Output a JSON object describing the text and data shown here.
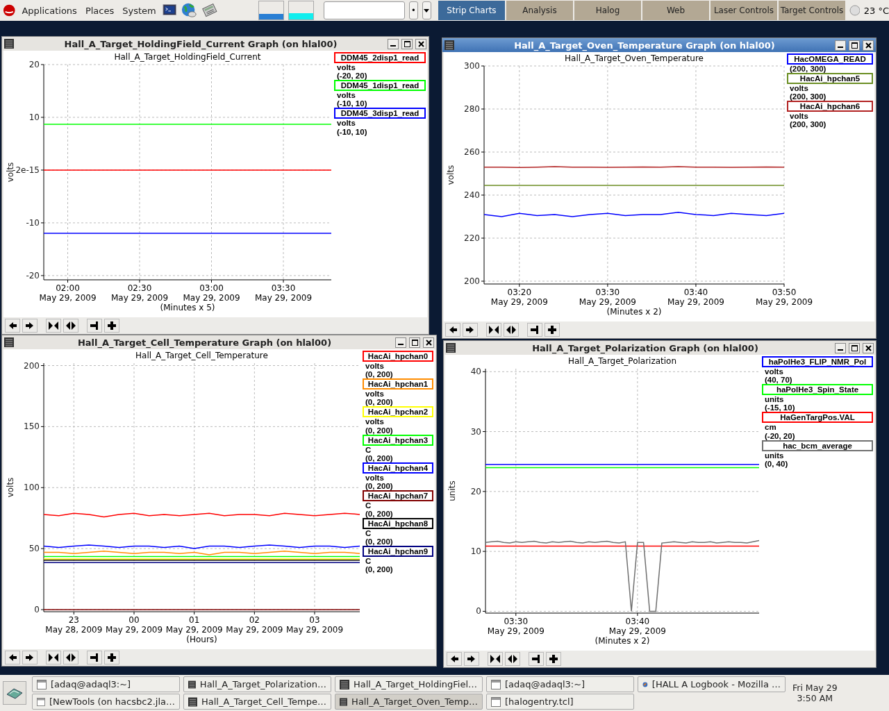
{
  "panel": {
    "menus": [
      "Applications",
      "Places",
      "System"
    ],
    "launchers": [
      {
        "kind": "terminal"
      },
      {
        "kind": "globe"
      },
      {
        "kind": "calculator"
      }
    ],
    "run_button": "•",
    "tabs": [
      {
        "label": "Strip Charts",
        "selected": true
      },
      {
        "label": "Analysis",
        "selected": false
      },
      {
        "label": "Halog",
        "selected": false
      },
      {
        "label": "Web",
        "selected": false
      },
      {
        "label": "Laser Controls",
        "selected": false
      },
      {
        "label": "Target Controls",
        "selected": false
      }
    ],
    "weather": "23 °C"
  },
  "windows": [
    {
      "title": "Hall_A_Target_HoldingField_Current Graph (on hlal00)",
      "active": false,
      "chart_data": {
        "type": "line",
        "title": "Hall_A_Target_HoldingField_Current",
        "xlabel": "(Minutes x 5)",
        "ylabel": "volts",
        "grid": true,
        "ylim": [
          -20.8,
          20
        ],
        "categories": [
          null,
          null,
          "02:00\nMay 29, 2009",
          null,
          null,
          null,
          null,
          null,
          "02:30\nMay 29, 2009",
          null,
          null,
          null,
          null,
          null,
          "03:00\nMay 29, 2009",
          null,
          null,
          null,
          null,
          null,
          "03:30\nMay 29, 2009",
          null,
          null,
          null,
          null
        ],
        "yticks": [
          20,
          10,
          {
            "value": 0,
            "label": "-2e-15"
          },
          -10,
          -20
        ],
        "series": [
          {
            "name": "DDM45_2disp1_read",
            "color": "#ff0000",
            "values": [
              0,
              0,
              0,
              0,
              0,
              0,
              0,
              0,
              0,
              0,
              0,
              0,
              0,
              0,
              0,
              0,
              0,
              0,
              0,
              0,
              0,
              0,
              0,
              0,
              0
            ]
          },
          {
            "name": "DDM45_1disp1_read",
            "color": "#00ff00",
            "values": [
              8.7,
              8.7,
              8.7,
              8.7,
              8.7,
              8.7,
              8.7,
              8.7,
              8.7,
              8.7,
              8.7,
              8.7,
              8.7,
              8.7,
              8.7,
              8.7,
              8.7,
              8.7,
              8.7,
              8.7,
              8.7,
              8.7,
              8.7,
              8.7,
              8.7
            ]
          },
          {
            "name": "DDM45_3disp1_read",
            "color": "#0000ff",
            "values": [
              -12,
              -12,
              -12,
              -12,
              -12,
              -12,
              -12,
              -12,
              -12,
              -12,
              -12,
              -12,
              -12,
              -12,
              -12,
              -12,
              -12,
              -12,
              -12,
              -12,
              -12,
              -12,
              -12,
              -12,
              -12
            ]
          }
        ]
      },
      "legend_details": [
        {
          "units": "volts",
          "range": "(-20, 20)"
        },
        {
          "units": "volts",
          "range": "(-10, 10)"
        },
        {
          "units": "volts",
          "range": "(-10, 10)"
        }
      ]
    },
    {
      "title": "Hall_A_Target_Oven_Temperature Graph (on hlal00)",
      "active": true,
      "chart_data": {
        "type": "line",
        "title": "Hall_A_Target_Oven_Temperature",
        "xlabel": "(Minutes x 2)",
        "ylabel": "volts",
        "grid": true,
        "ylim": [
          198.7,
          300
        ],
        "categories": [
          null,
          null,
          "03:20\nMay 29, 2009",
          null,
          null,
          null,
          null,
          "03:30\nMay 29, 2009",
          null,
          null,
          null,
          null,
          "03:40\nMay 29, 2009",
          null,
          null,
          null,
          null,
          "03:50\nMay 29, 2009"
        ],
        "yticks": [
          300,
          280,
          260,
          240,
          220,
          200
        ],
        "series": [
          {
            "name": "HacOMEGA_READ",
            "color": "#0000ff",
            "values": [
              231,
              230,
              231.5,
              230.5,
              231,
              230,
              231,
              231.5,
              230.5,
              231,
              231,
              232,
              231,
              230.5,
              231.5,
              231,
              230.5,
              231.5
            ]
          },
          {
            "name": "HacAi_hpchan5",
            "color": "#6b8e23",
            "values": [
              244.5,
              244.5,
              244.5,
              244.5,
              244.5,
              244.5,
              244.5,
              244.5,
              244.5,
              244.5,
              244.5,
              244.5,
              244.5,
              244.5,
              244.5,
              244.5,
              244.5,
              244.5
            ]
          },
          {
            "name": "HacAi_hpchan6",
            "color": "#b22222",
            "values": [
              253,
              253,
              252.8,
              253,
              253.2,
              253,
              253,
              252.9,
              253,
              253.1,
              253,
              253.2,
              253,
              253,
              252.9,
              253,
              253.1,
              253
            ]
          }
        ]
      },
      "legend_details": [
        {
          "range": "(200, 300)"
        },
        {
          "units": "volts",
          "range": "(200, 300)"
        },
        {
          "units": "volts",
          "range": "(200, 300)"
        }
      ]
    },
    {
      "title": "Hall_A_Target_Cell_Temperature Graph (on hlal00)",
      "active": false,
      "chart_data": {
        "type": "line",
        "title": "Hall_A_Target_Cell_Temperature",
        "xlabel": "(Hours)",
        "ylabel": "volts",
        "grid": true,
        "ylim": [
          -1.7,
          202
        ],
        "categories": [
          null,
          null,
          "23\nMay 28, 2009",
          null,
          null,
          null,
          "00\nMay 29, 2009",
          null,
          null,
          null,
          "01\nMay 29, 2009",
          null,
          null,
          null,
          "02\nMay 29, 2009",
          null,
          null,
          null,
          "03\nMay 29, 2009",
          null,
          null,
          null
        ],
        "yticks": [
          200,
          150,
          100,
          50,
          0
        ],
        "series": [
          {
            "name": "HacAi_hpchan0",
            "color": "#ff0000",
            "values": [
              78,
              77,
              79,
              78,
              76,
              78,
              79,
              77,
              78,
              77,
              78,
              79,
              77,
              78,
              78,
              77,
              79,
              78,
              77,
              78,
              79,
              78
            ]
          },
          {
            "name": "HacAi_hpchan1",
            "color": "#ff8c00",
            "values": [
              47,
              47,
              46,
              47,
              48,
              47,
              46,
              47,
              47,
              46,
              47,
              45,
              47,
              47,
              46,
              47,
              48,
              47,
              46,
              47,
              47,
              46
            ]
          },
          {
            "name": "HacAi_hpchan2",
            "color": "#ffff00",
            "values": [
              41.5,
              41.5,
              41.5,
              41.5,
              41.5,
              41.5,
              41.5,
              41.5,
              41.5,
              41.5,
              41.5,
              41.5,
              41.5,
              41.5,
              41.5,
              41.5,
              41.5,
              41.5,
              41.5,
              41.5,
              41.5,
              41.5
            ]
          },
          {
            "name": "HacAi_hpchan3",
            "color": "#00ff00",
            "values": [
              43.5,
              43.5,
              43.5,
              43.5,
              43.5,
              43.5,
              43.5,
              43.5,
              43.5,
              43.5,
              43.5,
              43.5,
              43.5,
              43.5,
              43.5,
              43.5,
              43.5,
              43.5,
              43.5,
              43.5,
              43.5,
              43.5
            ]
          },
          {
            "name": "HacAi_hpchan4",
            "color": "#0000ff",
            "values": [
              52,
              51,
              52,
              53,
              52,
              51,
              52,
              52,
              51,
              52,
              50,
              52,
              52,
              51,
              52,
              53,
              52,
              51,
              52,
              52,
              51,
              52
            ]
          },
          {
            "name": "HacAi_hpchan7",
            "color": "#800000",
            "values": [
              0,
              0,
              0,
              0,
              0,
              0,
              0,
              0,
              0,
              0,
              0,
              0,
              0,
              0,
              0,
              0,
              0,
              0,
              0,
              0,
              0,
              0
            ]
          },
          {
            "name": "HacAi_hpchan8",
            "color": "#000000",
            "values": [
              40.5,
              40.5,
              40.5,
              40.5,
              40.5,
              40.5,
              40.5,
              40.5,
              40.5,
              40.5,
              40.5,
              40.5,
              40.5,
              40.5,
              40.5,
              40.5,
              40.5,
              40.5,
              40.5,
              40.5,
              40.5,
              40.5
            ]
          },
          {
            "name": "HacAi_hpchan9",
            "color": "#000080",
            "values": [
              38.5,
              38.5,
              38.5,
              38.5,
              38.5,
              38.5,
              38.5,
              38.5,
              38.5,
              38.5,
              38.5,
              38.5,
              38.5,
              38.5,
              38.5,
              38.5,
              38.5,
              38.5,
              38.5,
              38.5,
              38.5,
              38.5
            ]
          }
        ]
      },
      "legend_details": [
        {
          "units": "volts",
          "range": "(0, 200)"
        },
        {
          "units": "volts",
          "range": "(0, 200)"
        },
        {
          "units": "volts",
          "range": "(0, 200)"
        },
        {
          "units": "C",
          "range": "(0, 200)"
        },
        {
          "units": "volts",
          "range": "(0, 200)"
        },
        {
          "units": "C",
          "range": "(0, 200)"
        },
        {
          "units": "C",
          "range": "(0, 200)"
        },
        {
          "units": "C",
          "range": "(0, 200)"
        }
      ]
    },
    {
      "title": "Hall_A_Target_Polarization Graph (on hlal00)",
      "active": false,
      "chart_data": {
        "type": "line",
        "title": "Hall_A_Target_Polarization",
        "xlabel": "(Minutes x 2)",
        "ylabel": "units",
        "grid": true,
        "ylim": [
          -0.3,
          40.5
        ],
        "categories": [
          null,
          null,
          null,
          null,
          null,
          "03:30\nMay 29, 2009",
          null,
          null,
          null,
          null,
          null,
          null,
          null,
          null,
          null,
          null,
          null,
          null,
          null,
          null,
          null,
          null,
          null,
          null,
          null,
          "03:40\nMay 29, 2009",
          null,
          null,
          null,
          null,
          null,
          null,
          null,
          null,
          null,
          null,
          null,
          null,
          null,
          null,
          null,
          null,
          null,
          null,
          null,
          null
        ],
        "yticks": [
          40,
          30,
          20,
          10,
          0
        ],
        "series": [
          {
            "name": "haPolHe3_FLIP_NMR_Pol",
            "color": "#0000ff",
            "values": [
              24.5,
              24.5,
              24.5,
              24.5,
              24.5,
              24.5,
              24.5,
              24.5,
              24.5,
              24.5,
              24.5,
              24.5,
              24.5,
              24.5,
              24.5,
              24.5,
              24.5,
              24.5,
              24.5,
              24.5,
              24.5,
              24.5,
              24.5,
              24.5,
              24.5,
              24.5,
              24.5,
              24.5,
              24.5,
              24.5,
              24.5,
              24.5,
              24.5,
              24.5,
              24.5,
              24.5,
              24.5,
              24.5,
              24.5,
              24.5,
              24.5,
              24.5,
              24.5,
              24.5,
              24.5,
              24.5
            ]
          },
          {
            "name": "haPolHe3_Spin_State",
            "color": "#00ff00",
            "values": [
              24,
              24,
              24,
              24,
              24,
              24,
              24,
              24,
              24,
              24,
              24,
              24,
              24,
              24,
              24,
              24,
              24,
              24,
              24,
              24,
              24,
              24,
              24,
              24,
              24,
              24,
              24,
              24,
              24,
              24,
              24,
              24,
              24,
              24,
              24,
              24,
              24,
              24,
              24,
              24,
              24,
              24,
              24,
              24,
              24,
              24
            ]
          },
          {
            "name": "HaGenTargPos.VAL",
            "color": "#ff0000",
            "values": [
              10.9,
              10.9,
              10.9,
              10.9,
              10.9,
              10.9,
              10.9,
              10.9,
              10.9,
              10.9,
              10.9,
              10.9,
              10.9,
              10.9,
              10.9,
              10.9,
              10.9,
              10.9,
              10.9,
              10.9,
              10.9,
              10.9,
              10.9,
              10.9,
              10.9,
              10.9,
              10.9,
              10.9,
              10.9,
              10.9,
              10.9,
              10.9,
              10.9,
              10.9,
              10.9,
              10.9,
              10.9,
              10.9,
              10.9,
              10.9,
              10.9,
              10.9,
              10.9,
              10.9,
              10.9,
              10.9
            ]
          },
          {
            "name": "hac_bcm_average",
            "color": "#707070",
            "values": [
              11.5,
              11.6,
              11.7,
              11.5,
              11.4,
              11.6,
              11.5,
              11.6,
              11.7,
              11.5,
              11.4,
              11.6,
              11.5,
              11.6,
              11.7,
              11.5,
              11.4,
              11.6,
              11.5,
              11.6,
              11.7,
              11.5,
              11.4,
              11.6,
              0,
              11.5,
              11.5,
              0,
              0,
              11.4,
              11.5,
              11.6,
              11.5,
              11.4,
              11.6,
              11.5,
              11.5,
              11.6,
              11.4,
              11.5,
              11.6,
              11.5,
              11.5,
              11.4,
              11.6,
              11.8
            ]
          }
        ]
      },
      "legend_details": [
        {
          "units": "volts",
          "range": "(40, 70)"
        },
        {
          "units": "units",
          "range": "(-15, 10)"
        },
        {
          "units": "cm",
          "range": "(-20, 20)"
        },
        {
          "units": "units",
          "range": "(0, 40)"
        }
      ]
    }
  ],
  "taskbar": {
    "items": [
      {
        "label": "[adaq@adaql3:~]",
        "kind": "window",
        "selected": false
      },
      {
        "label": "Hall_A_Target_Polarization…",
        "kind": "graph",
        "selected": false
      },
      {
        "label": "Hall_A_Target_HoldingFiel…",
        "kind": "graph",
        "selected": false
      },
      {
        "label": "[adaq@adaql3:~]",
        "kind": "window",
        "selected": false
      },
      {
        "label": "[HALL A Logbook - Mozilla …",
        "kind": "browser",
        "selected": false
      },
      {
        "label": "[NewTools (on hacsbc2.jla…",
        "kind": "window",
        "selected": false
      },
      {
        "label": "Hall_A_Target_Cell_Tempe…",
        "kind": "graph",
        "selected": false
      },
      {
        "label": "Hall_A_Target_Oven_Temp…",
        "kind": "graph",
        "selected": true
      },
      {
        "label": "[halogentry.tcl]",
        "kind": "window",
        "selected": false
      }
    ],
    "date": "Fri May 29",
    "time": "3:50 AM"
  }
}
